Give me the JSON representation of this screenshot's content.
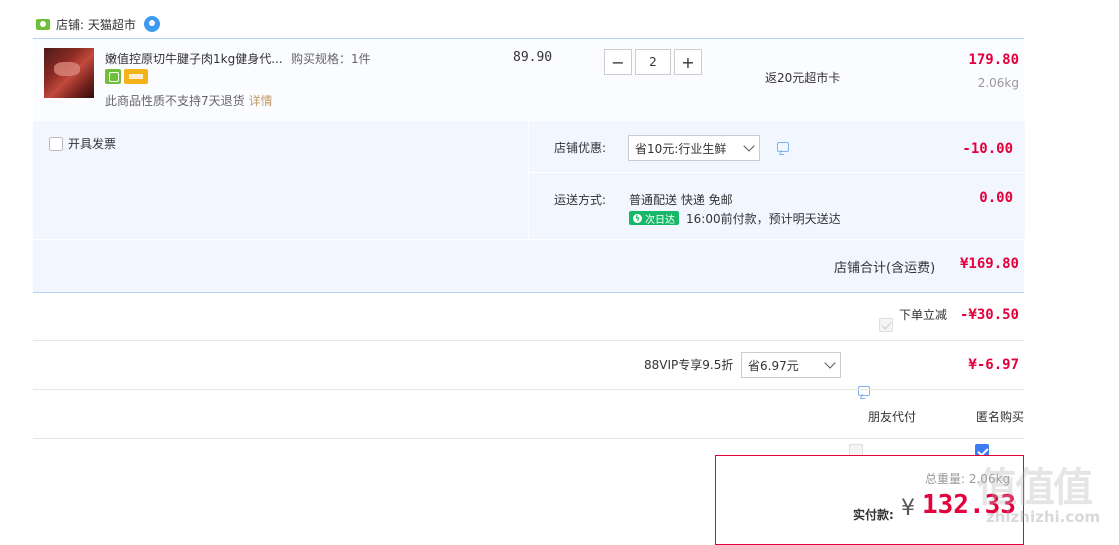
{
  "shop": {
    "label": "店铺: 天猫超市"
  },
  "item": {
    "title": "嫩值控原切牛腱子肉1kg健身代...",
    "spec": "购买规格：1件",
    "unit_price": "89.90",
    "quantity": "2",
    "minus": "−",
    "plus": "+",
    "rebate": "返20元超市卡",
    "subtotal": "179.80",
    "weight": "2.06kg",
    "no_return": "此商品性质不支持7天退货",
    "detail_link": "详情"
  },
  "options": {
    "invoice_label": "开具发票",
    "shop_discount_label": "店铺优惠:",
    "shop_discount_value": "省10元:行业生鲜",
    "shop_discount_amount": "-10.00",
    "shipping_label": "运送方式:",
    "shipping_method": "普通配送 快递 免邮",
    "shipping_fee": "0.00",
    "nextday_badge": "次日达",
    "shipping_note": "16:00前付款，预计明天送达"
  },
  "shop_total": {
    "label": "店铺合计(含运费)",
    "amount": "¥169.80"
  },
  "discounts": {
    "instant_label": "下单立减",
    "instant_amount": "-¥30.50",
    "vip_label": "88VIP专享9.5折",
    "vip_select_value": "省6.97元",
    "vip_amount": "¥-6.97"
  },
  "extras": {
    "friend_pay_label": "朋友代付",
    "anonymous_label": "匿名购买"
  },
  "payment": {
    "total_weight": "总重量: 2.06kg",
    "pay_label": "实付款:",
    "currency": "¥",
    "amount": "132.33"
  },
  "watermark": {
    "text": "值值值",
    "domain": "zhizhizhi.com"
  },
  "colors": {
    "accent_red": "#e4003a",
    "light_blue_bg": "#f2f7ff",
    "border_blue": "#b2d1ff",
    "checkbox_blue": "#3d7cf5",
    "nextday_green": "#18b86a"
  }
}
